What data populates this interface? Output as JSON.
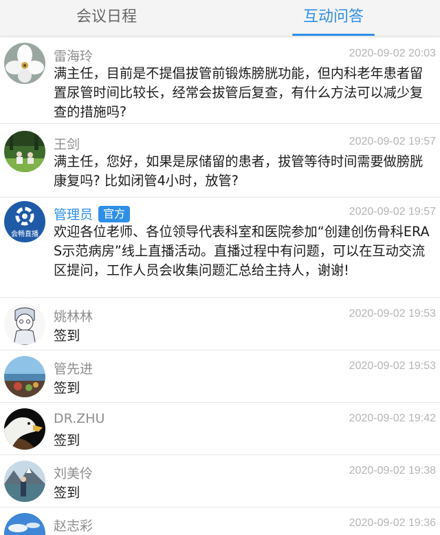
{
  "tabs": [
    {
      "label": "会议日程",
      "active": false
    },
    {
      "label": "互动问答",
      "active": true
    }
  ],
  "accent_color": "#2e8fe6",
  "messages": [
    {
      "name": "雷海玲",
      "time": "2020-09-02 20:03",
      "text": "满主任，目前是不提倡拔管前锻炼膀胱功能，但内科老年患者留置尿管时间比较长，经常会拔管后复查，有什么方法可以减少复查的措施吗?",
      "avatar": "white-flower-avatar"
    },
    {
      "name": "王剑",
      "time": "2020-09-02 19:57",
      "text": "满主任，您好，如果是尿储留的患者，拔管等待时间需要做膀胱康复吗? 比如闭管4小时，放管?",
      "avatar": "outdoor-people-avatar"
    },
    {
      "name": "管理员",
      "badge": "官方",
      "time": "2020-09-02 19:57",
      "text": "欢迎各位老师、各位领导代表科室和医院参加“创建创伤骨科ERAS示范病房”线上直播活动。直播过程中有问题，可以在互动交流区提问，工作人员会收集问题汇总给主持人，谢谢!",
      "avatar": "live-logo-avatar",
      "avatar_text": "会畅直播"
    },
    {
      "name": "姚林林",
      "time": "2020-09-02 19:53",
      "text": "签到",
      "avatar": "cartoon-boy-avatar"
    },
    {
      "name": "管先进",
      "time": "2020-09-02 19:53",
      "text": "签到",
      "avatar": "lake-scenery-avatar"
    },
    {
      "name": "DR.ZHU",
      "time": "2020-09-02 19:42",
      "text": "签到",
      "avatar": "eagle-avatar"
    },
    {
      "name": "刘美伶",
      "time": "2020-09-02 19:38",
      "text": "签到",
      "avatar": "mountain-photo-avatar"
    },
    {
      "name": "赵志彩",
      "time": "2020-09-02 19:36",
      "text": "",
      "avatar": "sky-avatar"
    }
  ]
}
